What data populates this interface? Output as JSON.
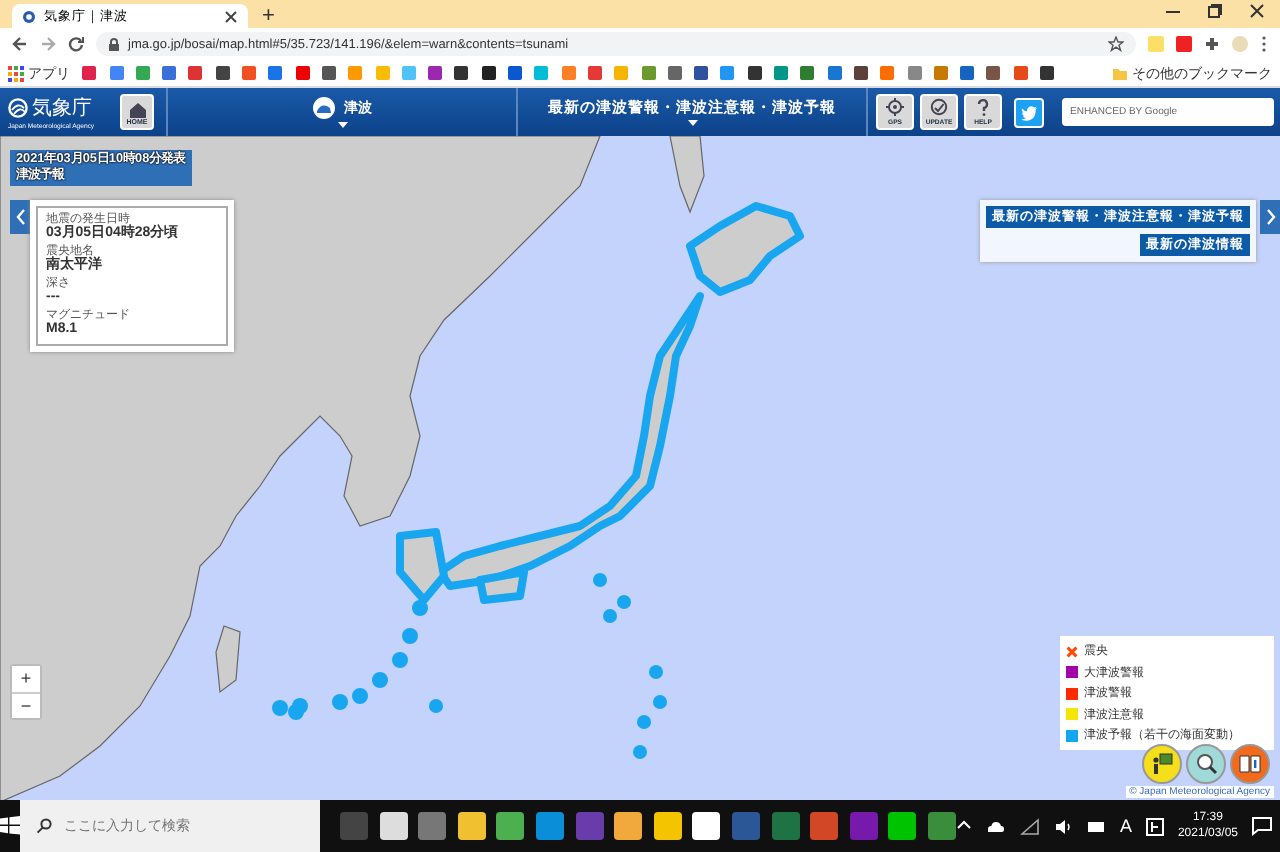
{
  "browser": {
    "tabs": [
      {
        "title": "気象庁｜津波",
        "selected": true
      }
    ],
    "new_tab": "+",
    "url": "jma.go.jp/bosai/map.html#5/35.723/141.196/&elem=warn&contents=tsunami",
    "bookmarks": {
      "apps": "アプリ",
      "other": "その他のブックマーク"
    }
  },
  "header": {
    "logo": "気象庁",
    "logo_sub": "Japan Meteorological Agency",
    "home": "HOME",
    "menu": "津波",
    "title_menu": "最新の津波警報・津波注意報・津波予報",
    "tools": [
      "GPS",
      "UPDATE",
      "HELP"
    ],
    "search": {
      "placeholder": "ENHANCED BY Google"
    }
  },
  "map": {
    "issued": "2021年03月05日10時08分発表",
    "issued_type": "津波予報",
    "info": [
      {
        "label": "地震の発生日時",
        "value": "03月05日04時28分頃"
      },
      {
        "label": "震央地名",
        "value": "南太平洋"
      },
      {
        "label": "深さ",
        "value": "---"
      },
      {
        "label": "マグニチュード",
        "value": "M8.1"
      }
    ],
    "links": [
      "最新の津波警報・津波注意報・津波予報",
      "最新の津波情報"
    ],
    "zoom": [
      "+",
      "−"
    ],
    "legend": [
      {
        "kind": "cross",
        "label": "震央",
        "color": "#ff4a00"
      },
      {
        "kind": "swatch",
        "label": "大津波警報",
        "color": "#a200a8"
      },
      {
        "kind": "swatch",
        "label": "津波警報",
        "color": "#ff2a00"
      },
      {
        "kind": "swatch",
        "label": "津波注意報",
        "color": "#f5e600"
      },
      {
        "kind": "swatch",
        "label": "津波予報（若干の海面変動）",
        "color": "#12a7f0"
      }
    ],
    "copyright": "© Japan Meteorological Agency"
  },
  "taskbar": {
    "search": {
      "placeholder": "ここに入力して検索"
    },
    "ime": "A",
    "time": "17:39",
    "date": "2021/03/05"
  }
}
